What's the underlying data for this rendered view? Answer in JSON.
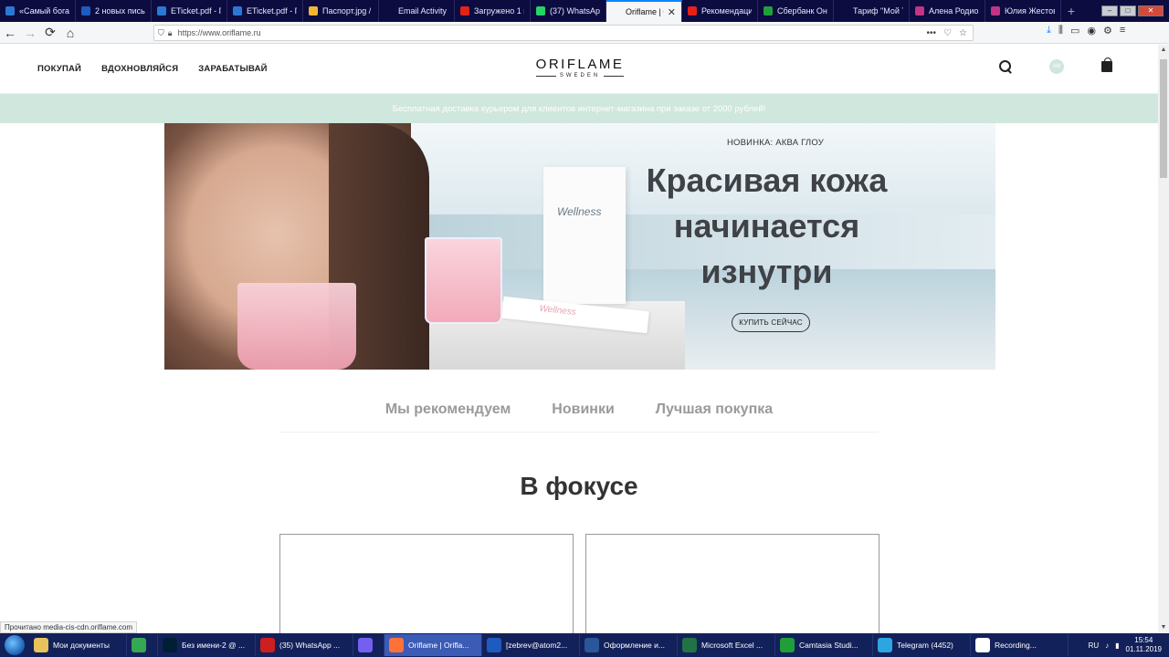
{
  "browser": {
    "tabs": [
      {
        "label": "«Самый богат",
        "color": "#2b78d4",
        "active": false
      },
      {
        "label": "2 новых письм",
        "color": "#1e5bbf",
        "active": false
      },
      {
        "label": "ETicket.pdf - П",
        "color": "#2b78d4",
        "active": false
      },
      {
        "label": "ETicket.pdf - П",
        "color": "#2b78d4",
        "active": false
      },
      {
        "label": "Паспорт.jpg /",
        "color": "#f2b634",
        "active": false
      },
      {
        "label": "Email Activity repo",
        "color": "#0c0c40",
        "active": false
      },
      {
        "label": "Загружено 1 и",
        "color": "#e62117",
        "active": false
      },
      {
        "label": "(37) WhatsApp",
        "color": "#25d366",
        "active": false
      },
      {
        "label": "Oriflame | O",
        "color": "#f5f6f7",
        "active": true
      },
      {
        "label": "Рекомендаци",
        "color": "#e62117",
        "active": false
      },
      {
        "label": "Сбербанк Онл",
        "color": "#21a038",
        "active": false
      },
      {
        "label": "Тариф \"Мой Т",
        "color": "#0c0c40",
        "active": false
      },
      {
        "label": "Алена Родион",
        "color": "#c13584",
        "active": false
      },
      {
        "label": "Юлия Жестов",
        "color": "#c13584",
        "active": false
      }
    ],
    "new_tab": "+",
    "url": "https://www.oriflame.ru",
    "status_text": "Прочитано media-cis-cdn.oriflame.com"
  },
  "header": {
    "nav": [
      "ПОКУПАЙ",
      "ВДОХНОВЛЯЙСЯ",
      "ЗАРАБАТЫВАЙ"
    ],
    "logo_main": "ORIFLAME",
    "logo_sub": "SWEDEN",
    "avatar_initials": "АМ"
  },
  "promo": {
    "text": "Бесплатная доставка курьером для клиентов интернет-магазина при заказе от 2000 рублей!"
  },
  "hero": {
    "kicker": "НОВИНКА: АКВА ГЛОУ",
    "title": "Красивая кожа начинается изнутри",
    "cta": "КУПИТЬ СЕЙЧАС",
    "product_brand": "Wellness"
  },
  "recommend_tabs": [
    "Мы рекомендуем",
    "Новинки",
    "Лучшая покупка"
  ],
  "focus": {
    "title": "В фокусе"
  },
  "taskbar": {
    "items": [
      {
        "label": "Мои документы",
        "color": "#e8c25a",
        "active": false
      },
      {
        "label": "",
        "color": "#34a853",
        "active": false
      },
      {
        "label": "Без имени-2 @ ...",
        "color": "#001e36",
        "active": false
      },
      {
        "label": "(35) WhatsApp ...",
        "color": "#cc1f1f",
        "active": false
      },
      {
        "label": "",
        "color": "#7360f2",
        "active": false
      },
      {
        "label": "Oriflame | Orifla...",
        "color": "#ff7139",
        "active": true
      },
      {
        "label": "[zebrev@atom2...",
        "color": "#1e5bbf",
        "active": false
      },
      {
        "label": "Оформление и...",
        "color": "#2b579a",
        "active": false
      },
      {
        "label": "Microsoft Excel ...",
        "color": "#217346",
        "active": false
      },
      {
        "label": "Camtasia Studi...",
        "color": "#1f9e3a",
        "active": false
      },
      {
        "label": "Telegram (4452)",
        "color": "#2ca5e0",
        "active": false
      },
      {
        "label": "Recording...",
        "color": "#ffffff",
        "active": false
      }
    ],
    "lang": "RU",
    "time": "15:54",
    "date": "01.11.2019"
  }
}
